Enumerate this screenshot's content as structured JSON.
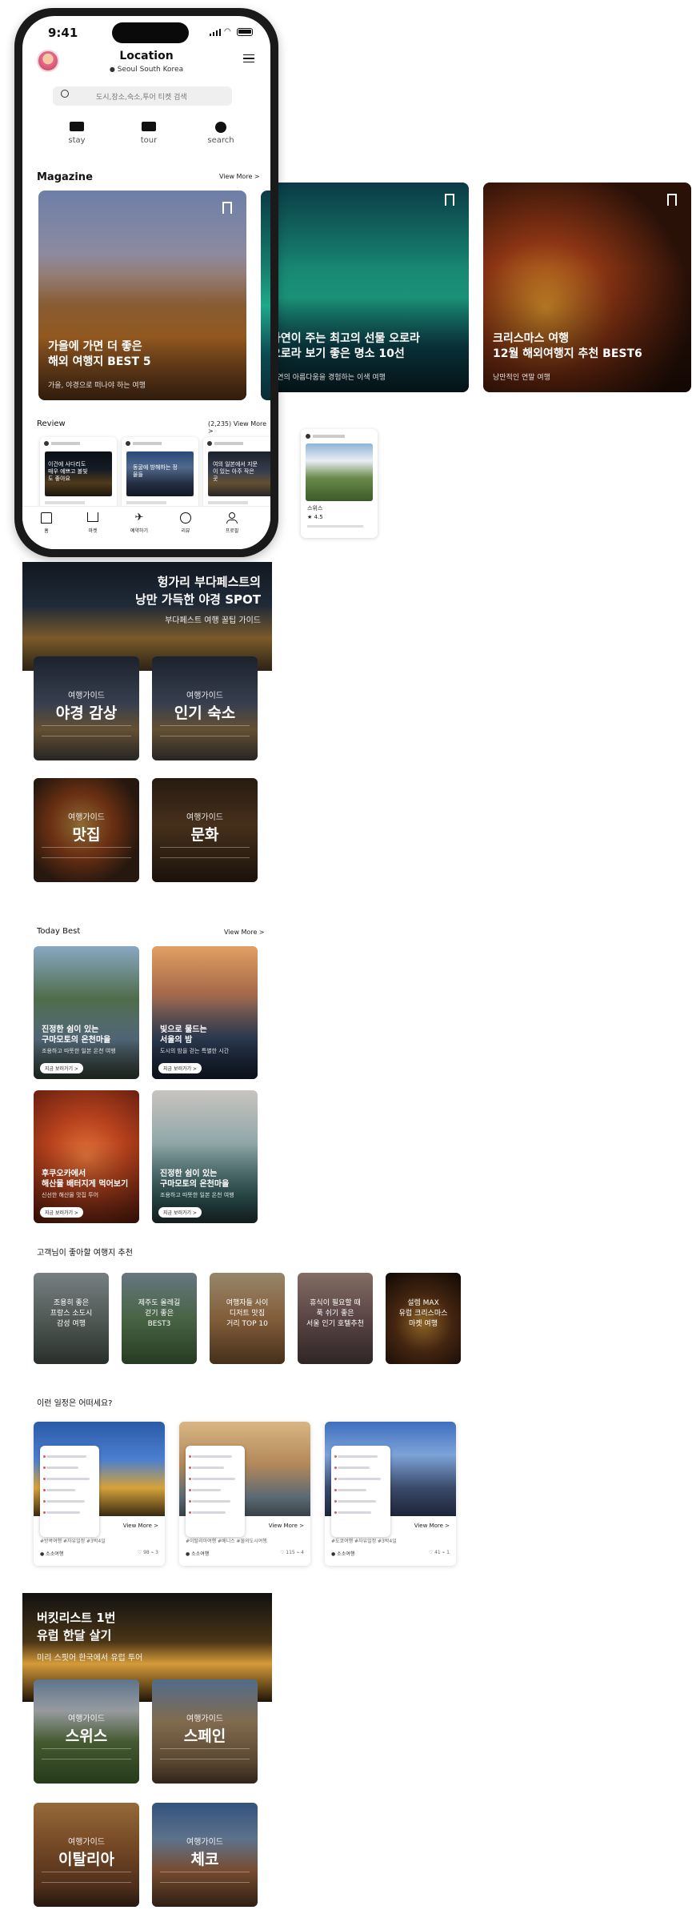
{
  "status_bar": {
    "time": "9:41"
  },
  "header": {
    "title": "Location",
    "subtitle": "Seoul South Korea"
  },
  "search": {
    "placeholder": "도시,장소,숙소,투어 티켓 검색"
  },
  "categories": [
    {
      "label": "stay",
      "icon": "bed-icon"
    },
    {
      "label": "tour",
      "icon": "ticket-icon"
    },
    {
      "label": "search",
      "icon": "restaurant-icon"
    }
  ],
  "magazine": {
    "title": "Magazine",
    "view_more": "View More >",
    "cards": [
      {
        "title_line1": "가을에 가면 더 좋은",
        "title_line2": "해외 여행지 BEST 5",
        "subtitle": "가을, 야경으로 떠나야 하는 여행"
      },
      {
        "title_line1": "자연이 주는 최고의 선물 오로라",
        "title_line2": "오로라 보기 좋은 명소 10선",
        "subtitle": "자연의 아름다움을 경험하는 이색 여행"
      },
      {
        "title_line1": "크리스마스 여행",
        "title_line2": "12월 해외여행지 추천 BEST6",
        "subtitle": "낭만적인 연말 여행"
      }
    ]
  },
  "review": {
    "title": "Review",
    "count_link": "(2,235) View More >",
    "cards": [
      {
        "caption": "이건에 사다리도 매우 예쁘고 볼빛도 좋아요"
      },
      {
        "caption": "동굴에 방해하는 정물들"
      },
      {
        "caption": "여의 일본에서 지문이 있는 아주 작은 곳"
      },
      {
        "caption": "스위스",
        "rating": "4.5"
      }
    ]
  },
  "bottom_nav": [
    {
      "label": "홈",
      "icon": "home-icon"
    },
    {
      "label": "마켓",
      "icon": "cart-icon"
    },
    {
      "label": "예약하기",
      "icon": "plane-icon"
    },
    {
      "label": "리뷰",
      "icon": "chat-icon"
    },
    {
      "label": "프로필",
      "icon": "profile-icon"
    }
  ],
  "budapest": {
    "banner_line1": "헝가리 부다페스트의",
    "banner_line2": "낭만 가득한 야경 SPOT",
    "banner_sub": "부다페스트 여행 꿀팁 가이드",
    "tiles": [
      {
        "sub": "여행가이드",
        "title": "야경 감상"
      },
      {
        "sub": "여행가이드",
        "title": "인기 숙소"
      },
      {
        "sub": "여행가이드",
        "title": "맛집"
      },
      {
        "sub": "여행가이드",
        "title": "문화"
      }
    ]
  },
  "today_best": {
    "title": "Today Best",
    "view_more": "View More >",
    "cards": [
      {
        "title_line1": "진정한 쉼이 있는",
        "title_line2": "구마모토의 온천마을",
        "sub": "조용하고 따뜻한 일본 온천 여행",
        "button": "지금 보러가기 >"
      },
      {
        "title_line1": "빛으로 물드는",
        "title_line2": "서울의 밤",
        "sub": "도시의 밤을 걷는 특별한 시간",
        "button": "지금 보러가기 >"
      },
      {
        "title_line1": "후쿠오카에서",
        "title_line2": "해산물 배터지게 먹어보기",
        "sub": "신선한 해산물 맛집 투어",
        "button": "지금 보러가기 >"
      },
      {
        "title_line1": "진정한 쉼이 있는",
        "title_line2": "구마모토의 온천마을",
        "sub": "조용하고 따뜻한 일본 온천 여행",
        "button": "지금 보러가기 >"
      }
    ]
  },
  "recommend": {
    "title": "고객님이 좋아할 여행지 추천",
    "cards": [
      {
        "line1": "조용히 좋은",
        "line2": "프랑스 소도시",
        "line3": "감성 여행"
      },
      {
        "line1": "제주도 올레길",
        "line2": "걷기 좋은",
        "line3": "BEST3"
      },
      {
        "line1": "여행자들 사이",
        "line2": "디저트 맛집",
        "line3": "거리 TOP 10"
      },
      {
        "line1": "휴식이 필요할 때",
        "line2": "푹 쉬기 좋은",
        "line3": "서울 인기 호텔추천"
      },
      {
        "line1": "설렘 MAX",
        "line2": "유럽 크리스마스",
        "line3": "마켓 여행"
      }
    ]
  },
  "itinerary": {
    "title": "이런 일정은 어떠세요?",
    "cards": [
      {
        "view_more": "View More >",
        "tags": "#방콕여행  #자유일정  #3박4일",
        "user": "소소여행",
        "stats": "♡ 98  ⌁ 3"
      },
      {
        "view_more": "View More >",
        "tags": "#이탈리아여행  #베니스  #물의도시여행",
        "user": "소소여행",
        "stats": "♡ 115  ⌁ 4"
      },
      {
        "view_more": "View More >",
        "tags": "#도쿄여행  #자유일정  #3박4일",
        "user": "소소여행",
        "stats": "♡ 41  ⌁ 1"
      }
    ]
  },
  "europe": {
    "banner_line1": "버킷리스트 1번",
    "banner_line2": "유럽 한달 살기",
    "banner_sub": "미리 스핏어 한국에서 유럽 투어",
    "tiles": [
      {
        "sub": "여행가이드",
        "title": "스위스"
      },
      {
        "sub": "여행가이드",
        "title": "스페인"
      },
      {
        "sub": "여행가이드",
        "title": "이탈리아"
      },
      {
        "sub": "여행가이드",
        "title": "체코"
      }
    ]
  }
}
